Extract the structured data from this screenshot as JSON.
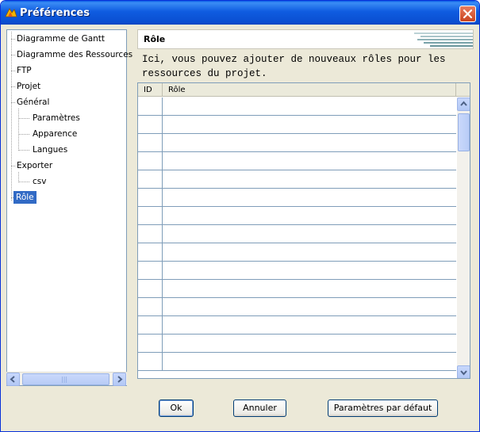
{
  "window": {
    "title": "Préférences"
  },
  "tree": {
    "items": [
      {
        "label": "Diagramme de Gantt"
      },
      {
        "label": "Diagramme des Ressources"
      },
      {
        "label": "FTP"
      },
      {
        "label": "Projet"
      },
      {
        "label": "Général"
      },
      {
        "label": "Paramètres"
      },
      {
        "label": "Apparence"
      },
      {
        "label": "Langues"
      },
      {
        "label": "Exporter"
      },
      {
        "label": "csv"
      },
      {
        "label": "Rôle"
      }
    ],
    "selected": "Rôle",
    "scroll_grip": "|||"
  },
  "panel": {
    "title": "Rôle",
    "description_line1": "Ici, vous pouvez ajouter de nouveaux rôles pour les",
    "description_line2": "ressources du projet."
  },
  "table": {
    "columns": [
      "ID",
      "Rôle"
    ],
    "rows": []
  },
  "buttons": {
    "ok": "Ok",
    "cancel": "Annuler",
    "defaults": "Paramètres par défaut"
  },
  "colors": {
    "titlebar": "#0a5ce6",
    "selection": "#316ac5",
    "dialog_bg": "#ece9d8"
  },
  "icons": [
    "app-icon",
    "close-icon",
    "chevron-left-icon",
    "chevron-right-icon",
    "chevron-up-icon",
    "chevron-down-icon"
  ]
}
